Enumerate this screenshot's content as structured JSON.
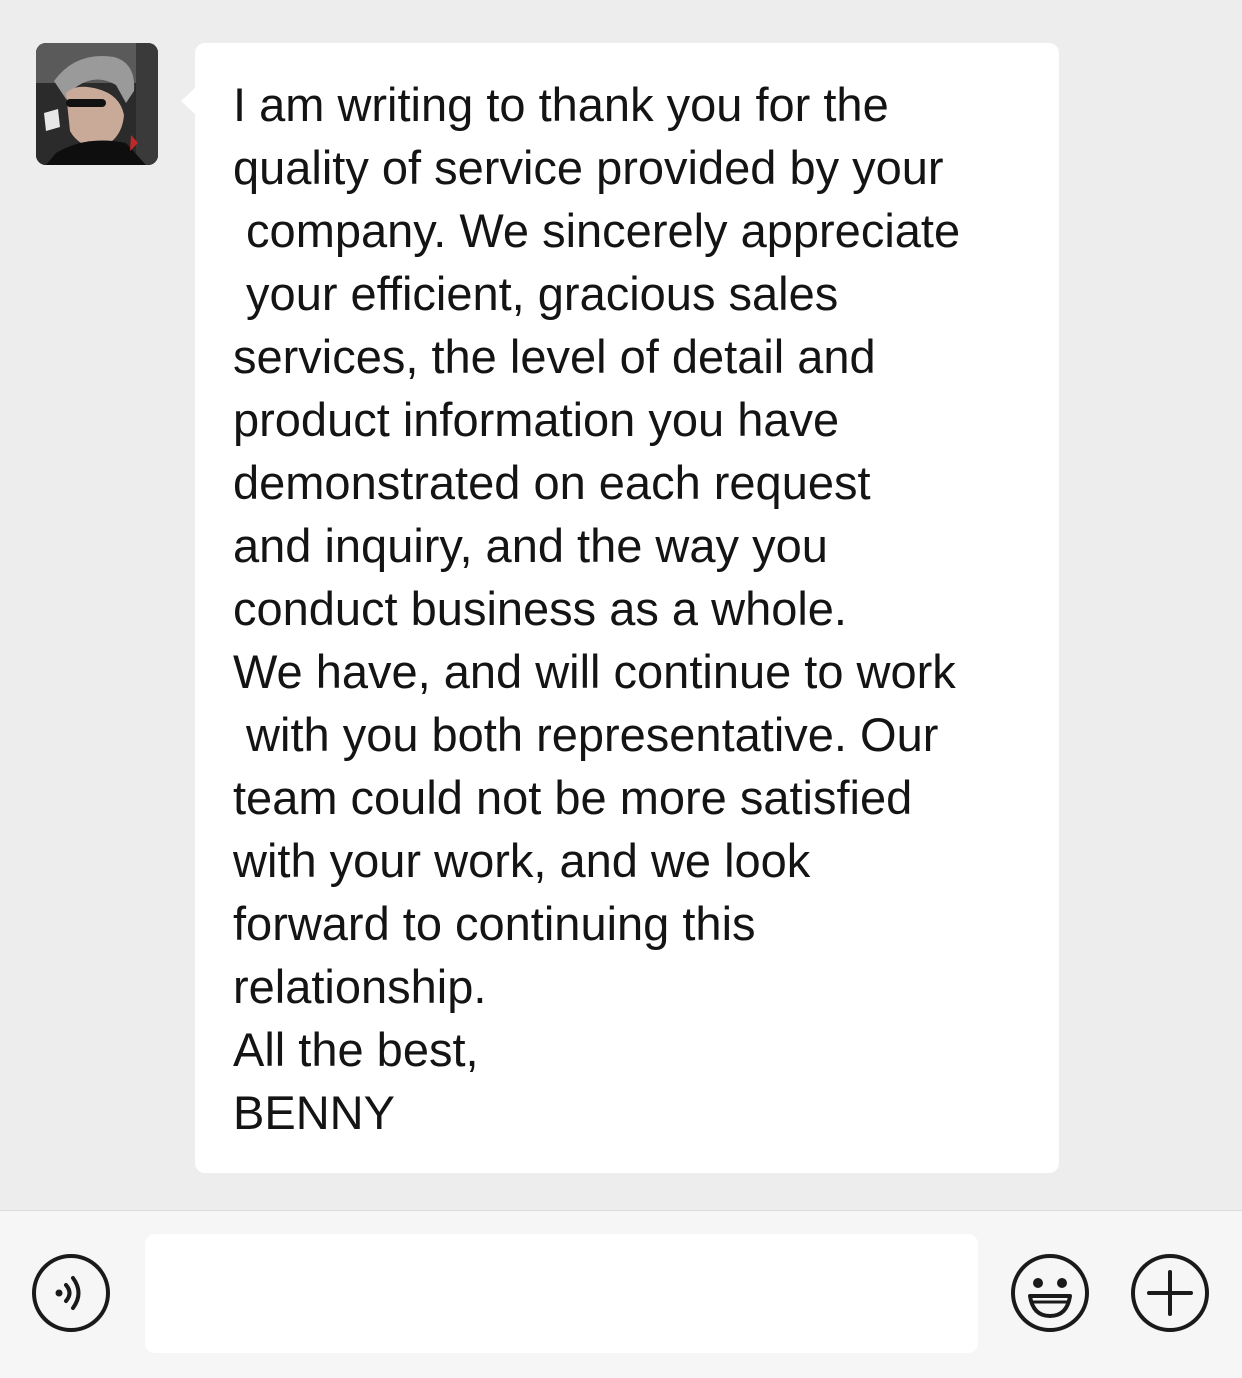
{
  "chat": {
    "message_lines": [
      "I am writing to thank you for the",
      "quality of service provided by your",
      " company. We sincerely appreciate",
      " your efficient, gracious sales",
      "services, the level of detail and",
      "product information you have",
      "demonstrated on each request",
      "and inquiry, and the way you",
      "conduct business as a whole.",
      "We have, and will continue to work",
      " with you both representative. Our",
      "team could not be more satisfied",
      "with your work, and we look",
      "forward to continuing this",
      "relationship.",
      "All the best,",
      "BENNY"
    ]
  },
  "input_bar": {
    "text_value": "",
    "icons": [
      "voice-icon",
      "emoji-icon",
      "plus-icon"
    ]
  },
  "colors": {
    "chat_background": "#ededed",
    "bubble_background": "#ffffff",
    "text": "#141414",
    "input_bar_background": "#f6f6f6"
  }
}
